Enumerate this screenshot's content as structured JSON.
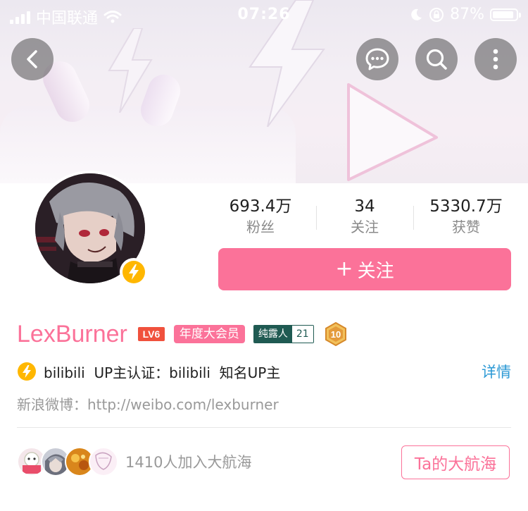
{
  "status_bar": {
    "carrier": "中国联通",
    "time": "07:26",
    "battery_percent_text": "87%",
    "battery_level": 0.87
  },
  "nav": {
    "back_icon": "chevron-left-icon",
    "message_icon": "chat-bubble-icon",
    "search_icon": "search-icon",
    "more_icon": "more-vertical-icon"
  },
  "profile": {
    "username": "LexBurner",
    "level_badge": "LV6",
    "vip_badge": "年度大会员",
    "fan_medal": {
      "name": "纯露人",
      "level": "21"
    },
    "honor_badge": "10",
    "verify_text": "bilibili  UP主认证：bilibili  知名UP主",
    "detail_link": "详情",
    "weibo_label": "新浪微博：",
    "weibo_url": "http://weibo.com/lexburner"
  },
  "stats": [
    {
      "value": "693.4万",
      "label": "粉丝"
    },
    {
      "value": "34",
      "label": "关注"
    },
    {
      "value": "5330.7万",
      "label": "获赞"
    }
  ],
  "follow_button": {
    "plus": "+",
    "label": "关注"
  },
  "fleet": {
    "text": "1410人加入大航海",
    "button": "Ta的大航海"
  },
  "colors": {
    "brand_pink": "#fb7299",
    "link_blue": "#2c99d5",
    "verify_yellow": "#ffb700",
    "medal_green": "#1f5a52",
    "level_red": "#f0513d"
  }
}
